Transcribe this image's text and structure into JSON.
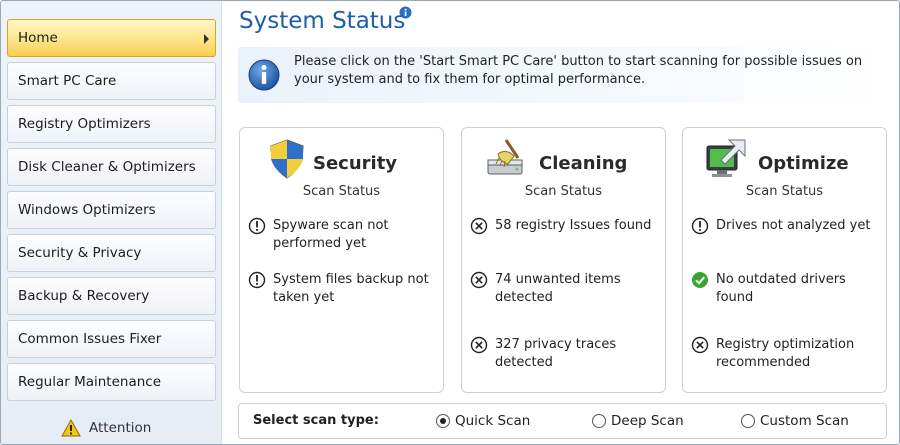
{
  "sidebar": {
    "items": [
      {
        "label": "Home",
        "active": true
      },
      {
        "label": "Smart PC Care"
      },
      {
        "label": "Registry Optimizers"
      },
      {
        "label": "Disk Cleaner & Optimizers"
      },
      {
        "label": "Windows Optimizers"
      },
      {
        "label": "Security & Privacy"
      },
      {
        "label": "Backup & Recovery"
      },
      {
        "label": "Common Issues Fixer"
      },
      {
        "label": "Regular Maintenance"
      }
    ],
    "attention_label": "Attention"
  },
  "main": {
    "title": "System Status",
    "info_message": "Please click on the 'Start Smart PC Care' button to start scanning for possible issues on your system and to fix them for optimal performance.",
    "cards": [
      {
        "title": "Security",
        "icon": "shield-icon",
        "scan_status_label": "Scan Status",
        "items": [
          {
            "status": "warning",
            "text": "Spyware scan not performed yet"
          },
          {
            "status": "warning",
            "text": "System files backup not taken yet"
          }
        ]
      },
      {
        "title": "Cleaning",
        "icon": "disk-cleaning-icon",
        "scan_status_label": "Scan Status",
        "items": [
          {
            "status": "error",
            "text": "58 registry Issues found"
          },
          {
            "status": "error",
            "text": "74 unwanted items detected"
          },
          {
            "status": "error",
            "text": "327 privacy traces detected"
          }
        ]
      },
      {
        "title": "Optimize",
        "icon": "monitor-optimize-icon",
        "scan_status_label": "Scan Status",
        "items": [
          {
            "status": "warning",
            "text": "Drives not analyzed yet"
          },
          {
            "status": "ok",
            "text": "No outdated drivers found"
          },
          {
            "status": "error",
            "text": "Registry optimization recommended"
          }
        ]
      }
    ],
    "scan_type": {
      "label": "Select scan type:",
      "options": [
        "Quick Scan",
        "Deep Scan",
        "Custom Scan"
      ],
      "selected": "Quick Scan"
    }
  },
  "colors": {
    "title_blue": "#1d5ea8",
    "active_nav": "#fde58a",
    "ok_green": "#3aa535"
  }
}
